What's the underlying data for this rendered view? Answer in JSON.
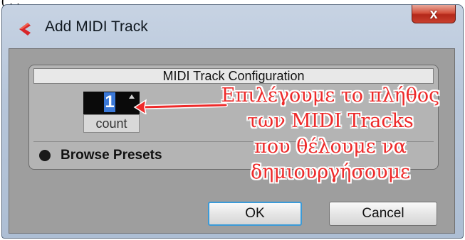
{
  "background_text": "(                                                              ,                 ,",
  "window": {
    "title": "Add MIDI Track",
    "icon": "cubase-logo-icon",
    "close_glyph": "x"
  },
  "config": {
    "header": "MIDI Track Configuration",
    "count_value": "1",
    "count_label": "count",
    "presets_label": "Browse Presets"
  },
  "buttons": {
    "ok": "OK",
    "cancel": "Cancel"
  },
  "annotation": {
    "lines": [
      "Επιλέγουμε το πλήθος",
      "των MIDI Tracks",
      "που θέλουμε να",
      "δημιουργήσουμε"
    ],
    "color": "#ee2a2a"
  },
  "colors": {
    "accent_focus": "#3a9ad8",
    "selection": "#3a78d8",
    "close": "#c8402e"
  }
}
